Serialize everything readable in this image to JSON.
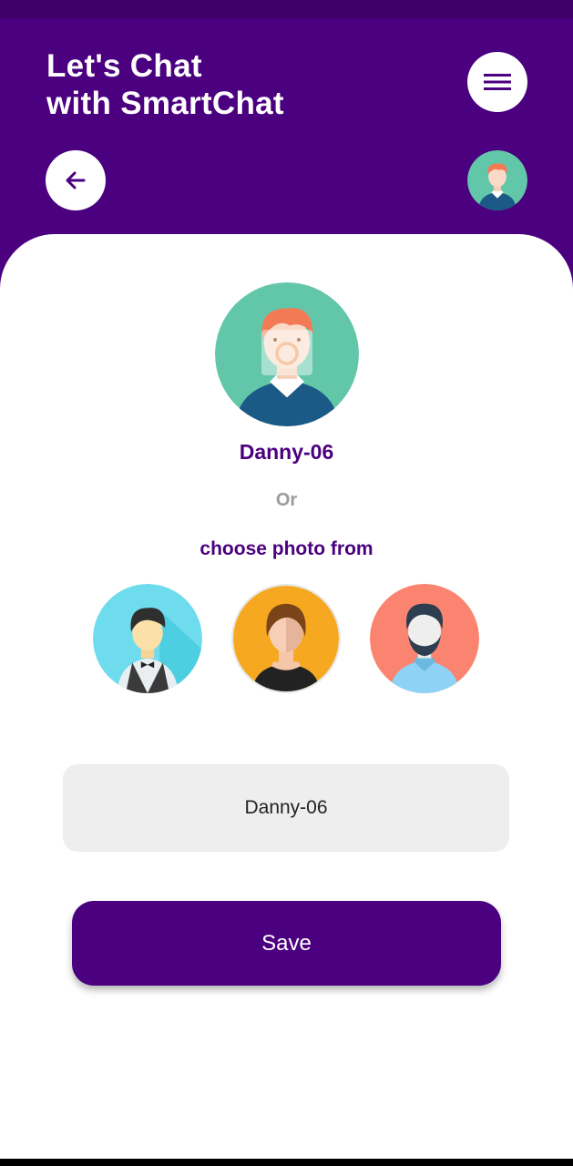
{
  "header": {
    "title": "Let's Chat\nwith SmartChat",
    "menu_icon": "hamburger-menu-icon",
    "back_icon": "arrow-left-icon"
  },
  "profile": {
    "display_name": "Danny-06",
    "camera_icon": "camera-icon"
  },
  "chooser": {
    "or_label": "Or",
    "prompt": "choose photo from",
    "options": [
      "waiter-avatar",
      "woman-avatar",
      "bearded-man-avatar"
    ]
  },
  "form": {
    "name_value": "Danny-06",
    "save_label": "Save"
  },
  "colors": {
    "brand": "#4b007f",
    "status_bar": "#3d0068",
    "field_bg": "#eeeeee",
    "muted_text": "#9b9b9b"
  }
}
